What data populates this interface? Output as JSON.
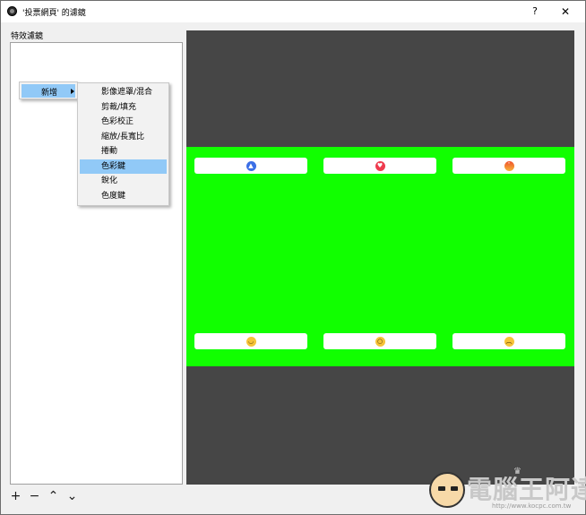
{
  "window": {
    "title": "'投票網頁' 的濾鏡",
    "help_label": "?",
    "close_label": "✕"
  },
  "filters_panel": {
    "label": "特效濾鏡"
  },
  "context_menu": {
    "add_label": "新增",
    "submenu_items": [
      {
        "label": "影像遮罩/混合",
        "selected": false
      },
      {
        "label": "剪裁/填充",
        "selected": false
      },
      {
        "label": "色彩校正",
        "selected": false
      },
      {
        "label": "縮放/長寬比",
        "selected": false
      },
      {
        "label": "捲動",
        "selected": false
      },
      {
        "label": "色彩鍵",
        "selected": true
      },
      {
        "label": "銳化",
        "selected": false
      },
      {
        "label": "色度鍵",
        "selected": false
      }
    ]
  },
  "preview": {
    "background_color": "#464646",
    "green_color": "#11ff00",
    "reactions": [
      {
        "name": "like",
        "icon": "like-icon",
        "glyph": "👍"
      },
      {
        "name": "love",
        "icon": "love-icon",
        "glyph": "♥"
      },
      {
        "name": "angry",
        "icon": "angry-icon",
        "glyph": "😠"
      },
      {
        "name": "haha",
        "icon": "haha-icon",
        "glyph": "😆"
      },
      {
        "name": "wow",
        "icon": "wow-icon",
        "glyph": "😮"
      },
      {
        "name": "sad",
        "icon": "sad-icon",
        "glyph": "☹"
      }
    ]
  },
  "toolbar": {
    "add_glyph": "+",
    "remove_glyph": "−",
    "up_glyph": "⌃",
    "down_glyph": "⌄"
  },
  "watermark": {
    "text": "電腦王阿達",
    "url": "http://www.kocpc.com.tw"
  }
}
